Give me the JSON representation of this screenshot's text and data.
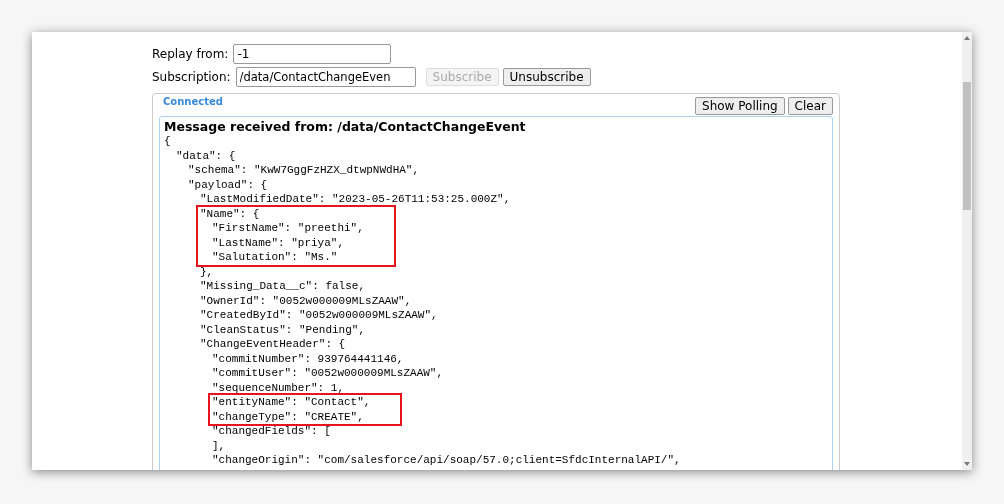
{
  "form": {
    "replay_from": {
      "label": "Replay from:",
      "value": "-1"
    },
    "subscription": {
      "label": "Subscription:",
      "value": "/data/ContactChangeEven"
    },
    "buttons": [
      {
        "label": "Subscribe",
        "disabled": true
      },
      {
        "label": "Unsubscribe",
        "disabled": false
      }
    ]
  },
  "panel": {
    "status": "Connected",
    "buttons": [
      "Show Polling",
      "Clear"
    ],
    "heading": "Message received from: /data/ContactChangeEvent",
    "lines": [
      {
        "text": "{",
        "children": [
          {
            "text": "\"data\": {",
            "children": [
              {
                "text": "\"schema\": \"KwW7GggFzHZX_dtwpNWdHA\","
              },
              {
                "text": "\"payload\": {",
                "children": [
                  {
                    "text": "\"LastModifiedDate\": \"2023-05-26T11:53:25.000Z\","
                  },
                  {
                    "kind": "highlight",
                    "lines": [
                      {
                        "text": "\"Name\": {",
                        "children": [
                          {
                            "text": "\"FirstName\": \"preethi\","
                          },
                          {
                            "text": "\"LastName\": \"priya\","
                          },
                          {
                            "text": "\"Salutation\": \"Ms.\""
                          }
                        ]
                      }
                    ]
                  },
                  {
                    "text": "},"
                  },
                  {
                    "text": "\"Missing_Data__c\": false,"
                  },
                  {
                    "text": "\"OwnerId\": \"0052w000009MLsZAAW\","
                  },
                  {
                    "text": "\"CreatedById\": \"0052w000009MLsZAAW\","
                  },
                  {
                    "text": "\"CleanStatus\": \"Pending\","
                  },
                  {
                    "text": "\"ChangeEventHeader\": {",
                    "children": [
                      {
                        "text": "\"commitNumber\": 939764441146,"
                      },
                      {
                        "text": "\"commitUser\": \"0052w000009MLsZAAW\","
                      },
                      {
                        "text": "\"sequenceNumber\": 1,"
                      },
                      {
                        "kind": "highlight",
                        "lines": [
                          {
                            "text": "\"entityName\": \"Contact\","
                          },
                          {
                            "text": "\"changeType\": \"CREATE\","
                          }
                        ]
                      },
                      {
                        "text": "\"changedFields\": ["
                      },
                      {
                        "text": "],"
                      },
                      {
                        "text": "\"changeOrigin\": \"com/salesforce/api/soap/57.0;client=SfdcInternalAPI/\","
                      }
                    ]
                  }
                ]
              }
            ]
          }
        ]
      }
    ]
  }
}
